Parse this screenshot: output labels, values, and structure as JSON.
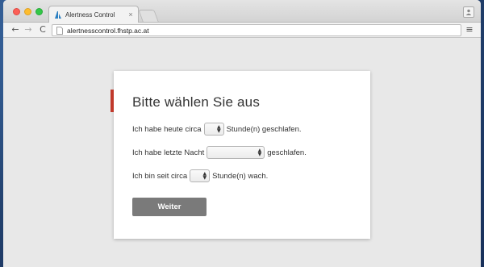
{
  "browser": {
    "tab_title": "Alertness Control",
    "tab_close": "×",
    "url": "alertnesscontrol.fhstp.ac.at",
    "nav_back": "←",
    "nav_forward": "→",
    "nav_reload": "C",
    "menu": "≡"
  },
  "form": {
    "heading": "Bitte wählen Sie aus",
    "row1": {
      "before": "Ich habe heute circa",
      "after": "Stunde(n) geschlafen."
    },
    "row2": {
      "before": "Ich habe letzte Nacht",
      "after": "geschlafen."
    },
    "row3": {
      "before": "Ich bin seit circa",
      "after": "Stunde(n) wach."
    },
    "submit_label": "Weiter",
    "accent_color": "#c0392b",
    "button_color": "#7a7a7a"
  }
}
